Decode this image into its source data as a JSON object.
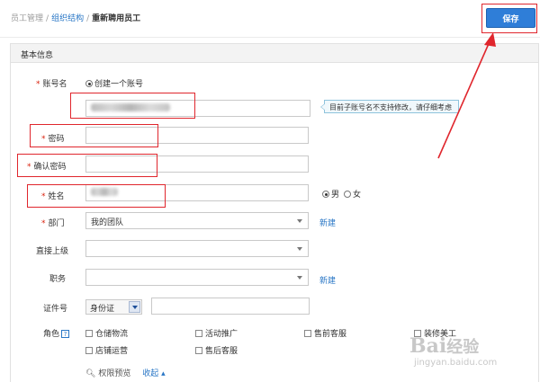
{
  "breadcrumb": {
    "items": [
      "员工管理",
      "组织结构"
    ],
    "current": "重新聘用员工"
  },
  "toolbar": {
    "save_label": "保存"
  },
  "section": {
    "title": "基本信息"
  },
  "form": {
    "account": {
      "label": "账号名",
      "radio_label": "创建一个账号",
      "tooltip": "目前子账号名不支持修改，请仔细考虑"
    },
    "password": {
      "label": "密码",
      "value": ""
    },
    "confirm_password": {
      "label": "确认密码",
      "value": ""
    },
    "name": {
      "label": "姓名",
      "gender_male": "男",
      "gender_female": "女",
      "selected_gender": "男"
    },
    "department": {
      "label": "部门",
      "value": "我的团队",
      "new_label": "新建"
    },
    "supervisor": {
      "label": "直接上级",
      "value": ""
    },
    "position": {
      "label": "职务",
      "value": "",
      "new_label": "新建"
    },
    "id_doc": {
      "label": "证件号",
      "type": "身份证",
      "value": ""
    },
    "roles": {
      "label": "角色",
      "help": "?",
      "options": [
        "仓储物流",
        "活动推广",
        "售前客服",
        "装修美工",
        "店铺运营",
        "售后客服"
      ]
    },
    "permissions": {
      "preview_label": "权限预览",
      "collapse_label": "收起 ▴"
    }
  },
  "watermark": {
    "text": "Bai经验",
    "sub": "jingyan.baidu.com"
  },
  "colors": {
    "primary": "#2f7ed8",
    "link": "#2a77c6",
    "required": "#d9230f",
    "annotation": "#e0262d"
  }
}
